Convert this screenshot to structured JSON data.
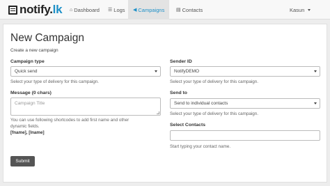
{
  "nav": {
    "brand_name": "notify",
    "brand_dot": ".",
    "brand_tld": "lk",
    "items": [
      {
        "icon": "home-icon",
        "glyph": "⌂",
        "label": "Dashboard"
      },
      {
        "icon": "list-icon",
        "glyph": "☰",
        "label": "Logs"
      },
      {
        "icon": "megaphone-icon",
        "glyph": "◀",
        "label": "Campaigns",
        "active": true
      },
      {
        "icon": "contacts-icon",
        "glyph": "▤",
        "label": "Contacts"
      }
    ],
    "user": "Kasun"
  },
  "page": {
    "title": "New Campaign",
    "subtitle": "Create a new campaign"
  },
  "form": {
    "campaign_type": {
      "label": "Campaign type",
      "value": "Quick send",
      "help": "Select your type of delivery for this campaign."
    },
    "sender_id": {
      "label": "Sender ID",
      "value": "NotifyDEMO",
      "help": "Select your type of delivery for this campaign."
    },
    "message": {
      "label": "Message (0 chars)",
      "placeholder": "Campaign Title",
      "help_line1": "You can use following shortcodes to add first name and other",
      "help_line2": "dynamic fields.",
      "shortcodes": "[fname], [lname]"
    },
    "send_to": {
      "label": "Send to",
      "value": "Send to individual contacts",
      "help": "Select your type of delivery for this campaign."
    },
    "select_contacts": {
      "label": "Select Contacts",
      "value": "",
      "help": "Start typing your contact name."
    },
    "submit_label": "Submit"
  },
  "colors": {
    "accent": "#1d90c8",
    "button": "#555555"
  }
}
